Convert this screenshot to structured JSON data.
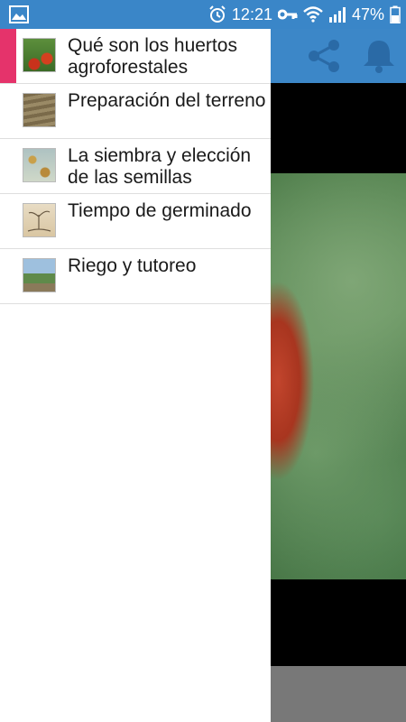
{
  "status_bar": {
    "time": "12:21",
    "battery": "47%",
    "icons": [
      "image-icon",
      "alarm-icon",
      "key-icon",
      "wifi-icon",
      "signal-icon",
      "battery-icon"
    ]
  },
  "app_bar": {
    "actions": [
      "share-icon",
      "bell-icon"
    ],
    "color": "#3c87c8"
  },
  "drawer": {
    "accent_color": "#e5336b",
    "items": [
      {
        "label": "Qué son los huertos agroforestales",
        "thumb": "tomatoes"
      },
      {
        "label": "Preparación del terreno",
        "thumb": "plowed-field"
      },
      {
        "label": "La siembra y elección de las semillas",
        "thumb": "seeds"
      },
      {
        "label": "Tiempo de germinado",
        "thumb": "sketch"
      },
      {
        "label": "Riego y tutoreo",
        "thumb": "garden"
      }
    ]
  }
}
